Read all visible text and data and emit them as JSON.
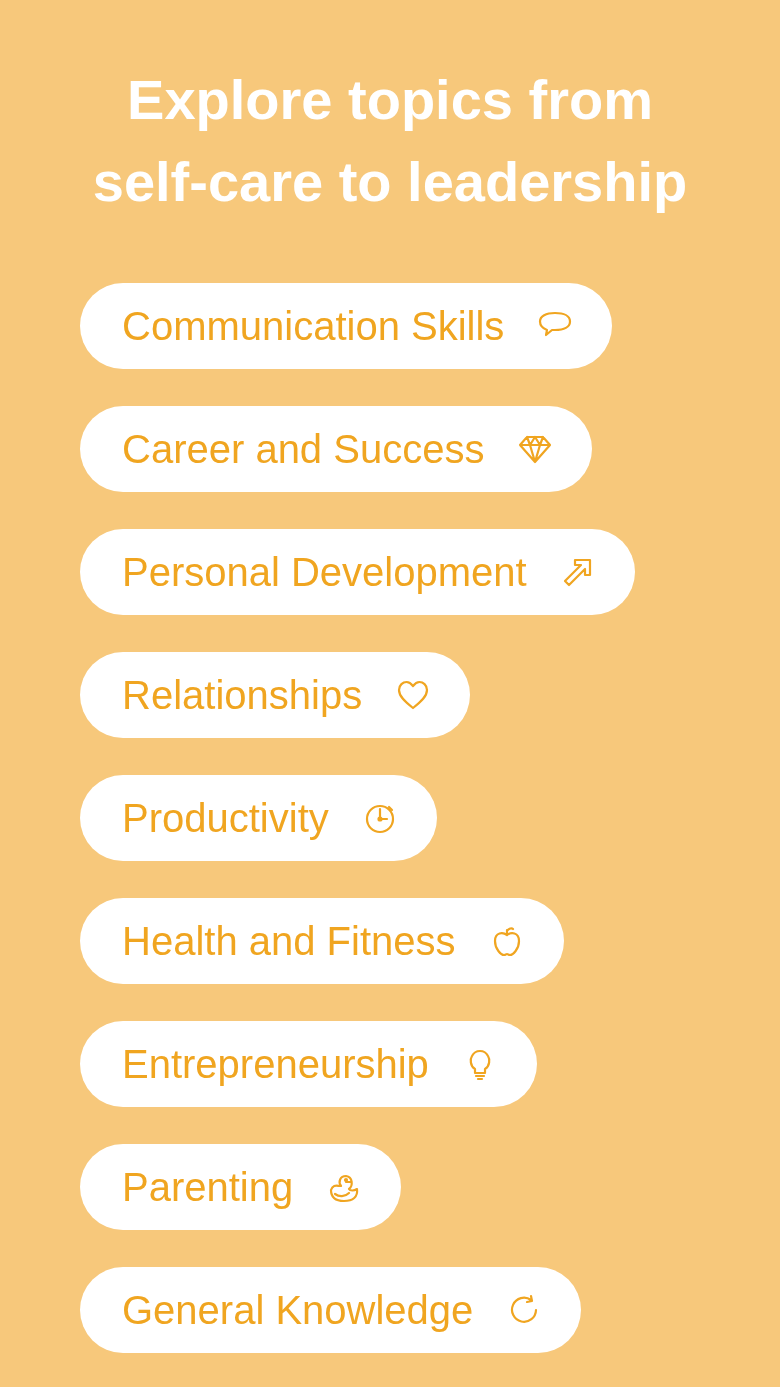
{
  "heading": "Explore topics from self-care to leadership",
  "topics": [
    {
      "label": "Communication Skills",
      "kind": "speech"
    },
    {
      "label": "Career and Success",
      "kind": "diamond"
    },
    {
      "label": "Personal Development",
      "kind": "arrow"
    },
    {
      "label": "Relationships",
      "kind": "heart"
    },
    {
      "label": "Productivity",
      "kind": "timer"
    },
    {
      "label": "Health and Fitness",
      "kind": "apple"
    },
    {
      "label": "Entrepreneurship",
      "kind": "bulb"
    },
    {
      "label": "Parenting",
      "kind": "duck"
    },
    {
      "label": "General Knowledge",
      "kind": "refresh"
    }
  ]
}
